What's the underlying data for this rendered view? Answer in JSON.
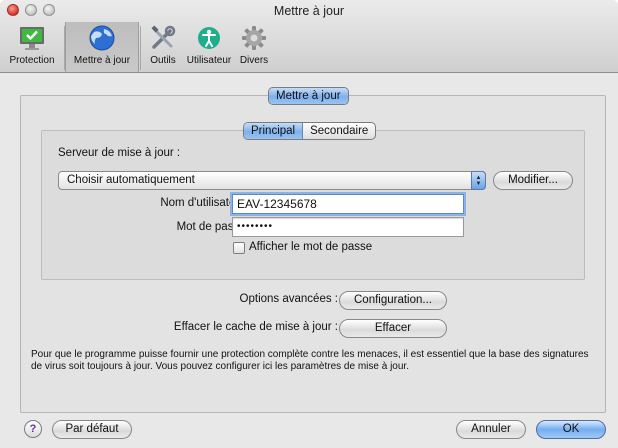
{
  "window": {
    "title": "Mettre à jour"
  },
  "toolbar": {
    "items": [
      {
        "label": "Protection",
        "icon": "monitor-check-icon"
      },
      {
        "label": "Mettre à jour",
        "icon": "globe-icon",
        "selected": true
      },
      {
        "label": "Outils",
        "icon": "tools-icon"
      },
      {
        "label": "Utilisateur",
        "icon": "accessibility-icon"
      },
      {
        "label": "Divers",
        "icon": "gear-icon"
      }
    ]
  },
  "main": {
    "section_tab": "Mettre à jour",
    "tabs": [
      {
        "label": "Principal",
        "selected": true
      },
      {
        "label": "Secondaire",
        "selected": false
      }
    ],
    "server_label": "Serveur de mise à jour :",
    "server_value": "Choisir automatiquement",
    "modify_button": "Modifier...",
    "username_label": "Nom d'utilisateur :",
    "username_value": "EAV-12345678",
    "password_label": "Mot de passe :",
    "password_value": "••••••••",
    "show_password_label": "Afficher le mot de passe",
    "show_password_checked": false,
    "advanced_label": "Options avancées :",
    "config_button": "Configuration...",
    "clear_cache_label": "Effacer le cache de mise à jour :",
    "clear_button": "Effacer",
    "note": "Pour que le programme puisse fournir une protection complète contre les menaces, il est essentiel que la base des signatures de virus soit toujours à jour. Vous pouvez configurer ici les paramètres de mise à jour."
  },
  "footer": {
    "help": "?",
    "default_button": "Par défaut",
    "cancel_button": "Annuler",
    "ok_button": "OK"
  },
  "colors": {
    "accent": "#7eb0ec",
    "title_bar": "#d8d8d8",
    "background": "#e8e8e8"
  }
}
